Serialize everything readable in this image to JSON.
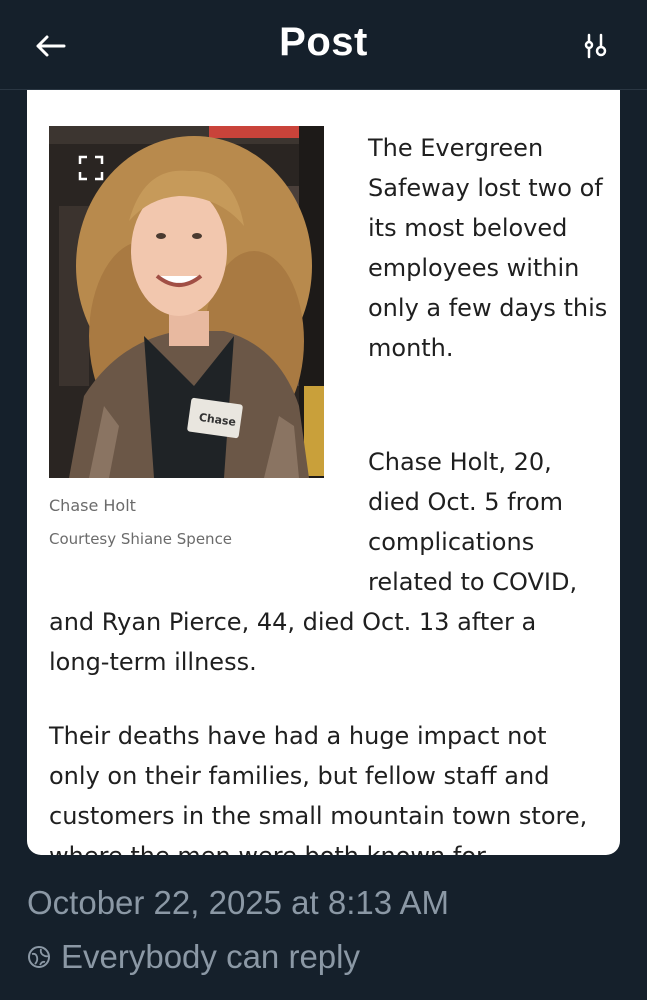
{
  "header": {
    "title": "Post",
    "back_icon": "arrow-left-icon",
    "filter_icon": "sliders-icon"
  },
  "article": {
    "photo_badge_text": "Chase",
    "caption_name": "Chase Holt",
    "caption_credit": "Courtesy Shiane Spence",
    "paragraph_1": "The Evergreen Safeway lost two of its most beloved employees within only a few days this month.",
    "paragraph_2_side": "Chase Holt, 20, died Oct. 5 from complications related to COVID,",
    "paragraph_2_full": "and Ryan Pierce, 44, died Oct. 13 after a long-term illness.",
    "paragraph_3": "Their deaths have had a huge impact not only on their families, but fellow staff and customers in the small mountain town store, where the men were both known for"
  },
  "footer": {
    "timestamp": "October 22, 2025 at 8:13 AM",
    "reply_setting": "Everybody can reply",
    "reply_icon": "globe-icon"
  },
  "colors": {
    "background": "#15202b",
    "muted_text": "#8b98a5",
    "card": "#ffffff"
  }
}
